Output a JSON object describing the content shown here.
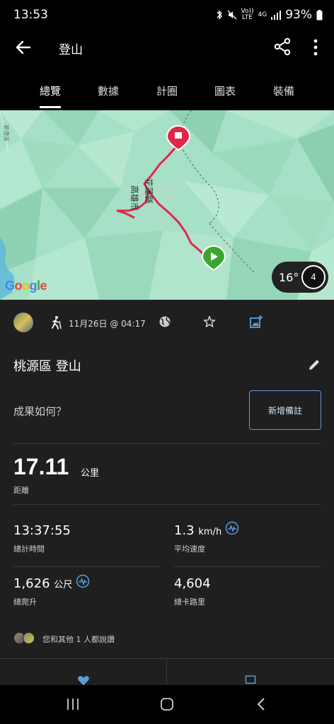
{
  "status_bar": {
    "time": "13:53",
    "volte_label": "Vo)) LTE",
    "network_label": "4G",
    "battery_pct": "93%"
  },
  "app_bar": {
    "title": "登山",
    "back_icon": "arrow-left-icon",
    "share_icon": "share-icon",
    "more_icon": "more-vertical-icon"
  },
  "tabs": [
    {
      "label": "總覽",
      "active": true
    },
    {
      "label": "數據",
      "active": false
    },
    {
      "label": "計圈",
      "active": false
    },
    {
      "label": "圖表",
      "active": false
    },
    {
      "label": "裝備",
      "active": false
    }
  ],
  "map": {
    "labels": {
      "county_a": "花蓮縣",
      "county_b": "高雄市",
      "river": "荖濃溪"
    },
    "temperature": "16°",
    "wind_speed": "4",
    "attribution": "Google",
    "colors": {
      "route": "#e0274a",
      "start": "#3aa632",
      "end": "#e0274a"
    }
  },
  "activity": {
    "date": "11月26日 @ 04:17",
    "title": "桃源區 登山",
    "feel_question": "成果如何？",
    "add_note_label": "新增備註"
  },
  "stats": {
    "distance": {
      "value": "17.11",
      "unit": "公里",
      "label": "距離"
    },
    "total_time": {
      "value": "13:37:55",
      "label": "總計時間"
    },
    "avg_speed": {
      "value": "1.3",
      "unit": "km/h",
      "label": "平均速度"
    },
    "total_ascent": {
      "value": "1,626",
      "unit": "公尺",
      "label": "總爬升"
    },
    "calories": {
      "value": "4,604",
      "label": "總卡路里"
    }
  },
  "social": {
    "likes_text": "您和其他 1 人都說讚"
  },
  "accent_color": "#5b9dd9"
}
